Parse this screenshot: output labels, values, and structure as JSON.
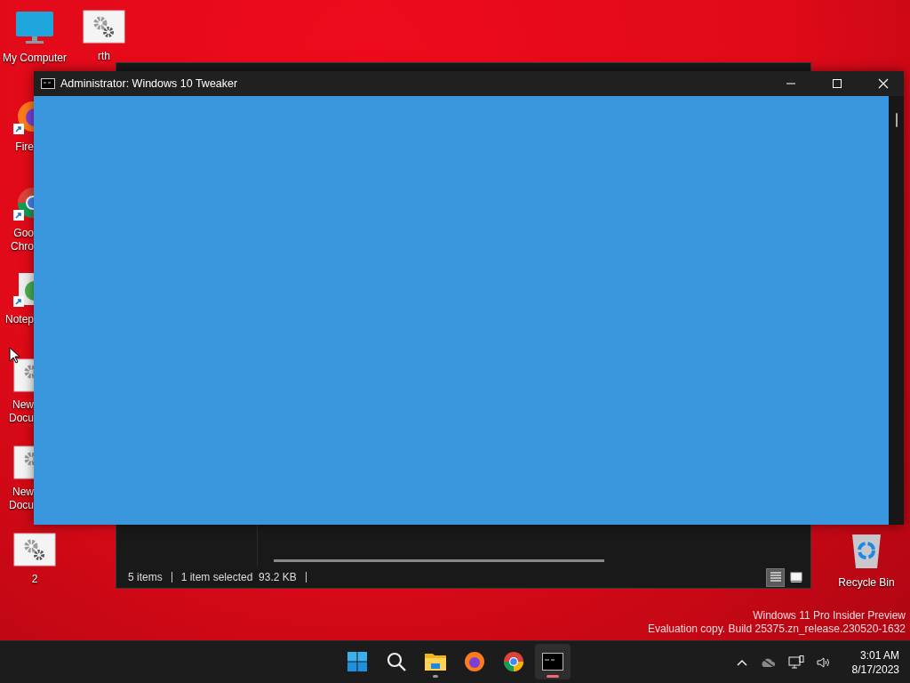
{
  "desktop_icons": [
    {
      "kind": "monitor",
      "lines": [
        "My Computer"
      ],
      "cut": false,
      "shortcut": false
    },
    {
      "kind": "settings",
      "lines": [
        "rth"
      ],
      "cut": false,
      "shortcut": false
    },
    {
      "kind": "firefox",
      "lines": [
        "Fire"
      ],
      "cut": true,
      "shortcut": true
    },
    {
      "kind": "chrome",
      "lines": [
        "Goo",
        "Chro"
      ],
      "cut": true,
      "shortcut": true
    },
    {
      "kind": "notepad",
      "lines": [
        "Notep"
      ],
      "cut": true,
      "shortcut": true
    },
    {
      "kind": "settings",
      "lines": [
        "New",
        "Docu"
      ],
      "cut": true,
      "shortcut": false
    },
    {
      "kind": "settings",
      "lines": [
        "New",
        "Docu"
      ],
      "cut": true,
      "shortcut": false
    },
    {
      "kind": "settings",
      "lines": [
        "2"
      ],
      "cut": false,
      "shortcut": false
    },
    {
      "kind": "recycle",
      "lines": [
        "Recycle Bin"
      ],
      "cut": false,
      "shortcut": false
    }
  ],
  "explorer": {
    "status": [
      "5 items",
      "1 item selected  93.2 KB"
    ],
    "views": [
      {
        "kind": "details",
        "selected": true
      },
      {
        "kind": "tiles",
        "selected": false
      }
    ]
  },
  "console": {
    "title": "Administrator:  Windows 10 Tweaker"
  },
  "watermark": [
    "Windows 11 Pro Insider Preview",
    "Evaluation copy. Build 25375.zn_release.230520-1632"
  ],
  "taskbar": {
    "apps": [
      {
        "kind": "start",
        "running": false,
        "active": false
      },
      {
        "kind": "search",
        "running": false,
        "active": false
      },
      {
        "kind": "explorer",
        "running": true,
        "active": false
      },
      {
        "kind": "firefox",
        "running": false,
        "active": false
      },
      {
        "kind": "chrome",
        "running": false,
        "active": false
      },
      {
        "kind": "terminal",
        "running": true,
        "active": true
      }
    ],
    "tray": [
      {
        "kind": "chevron"
      },
      {
        "kind": "cloud"
      },
      {
        "kind": "network"
      },
      {
        "kind": "volume"
      }
    ],
    "time": "3:01 AM",
    "date": "8/17/2023"
  }
}
